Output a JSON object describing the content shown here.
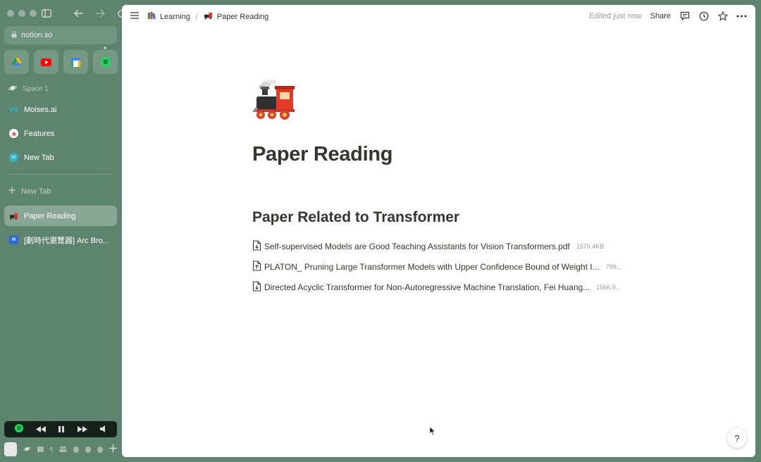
{
  "browser": {
    "url": "notion.so",
    "favorites": [
      "google-drive",
      "youtube",
      "calendar",
      "spotify"
    ],
    "calendar_day": "26",
    "space_label": "Space 1",
    "tabs": [
      {
        "label": "Moises.ai",
        "icon": "moises-icon",
        "color": "#2bb5c4"
      },
      {
        "label": "Features",
        "icon": "features-icon",
        "color": "#e0516a"
      },
      {
        "label": "New Tab",
        "icon": "newtab-icon",
        "color": "#36b3c9"
      }
    ],
    "new_tab_label": "New Tab",
    "lower_tabs": [
      {
        "label": "Paper Reading",
        "icon": "train-icon",
        "active": true
      },
      {
        "label": "[劃時代瀏覽器] Arc Bro...",
        "icon": "h-icon",
        "badge": "H",
        "active": false
      }
    ]
  },
  "notion": {
    "breadcrumb": [
      {
        "label": "Learning",
        "icon": "books-icon"
      },
      {
        "label": "Paper Reading",
        "icon": "train-icon"
      }
    ],
    "edited": "Edited just now",
    "share": "Share",
    "page_title": "Paper Reading",
    "heading": "Paper Related to Transformer",
    "files": [
      {
        "name": "Self-supervised Models are Good Teaching Assistants for Vision Transformers.pdf",
        "size": "1579.4KB"
      },
      {
        "name": "PLATON_ Pruning Large Transformer Models with Upper Confidence Bound of Weight I...",
        "size": "799..."
      },
      {
        "name": "Directed Acyclic Transformer for Non-Autoregressive Machine Translation, Fei Huang...",
        "size": "1566.9..."
      }
    ],
    "help": "?"
  },
  "colors": {
    "sidebar_bg": "#5e8470",
    "text": "#37352f",
    "muted": "#9b9a97"
  }
}
